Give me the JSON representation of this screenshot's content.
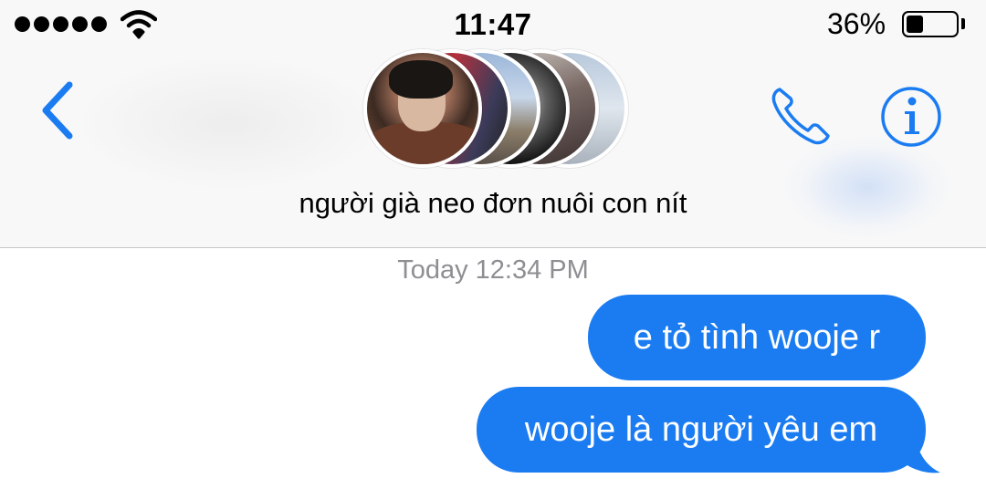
{
  "status_bar": {
    "time": "11:47",
    "battery_percent": "36%",
    "battery_level": 0.36,
    "signal_bars": 5
  },
  "nav": {
    "back_icon": "chevron-left-icon",
    "call_icon": "phone-icon",
    "info_icon": "info-icon",
    "accent_color": "#1b7cf2"
  },
  "conversation": {
    "title": "người già neo đơn nuôi con nít",
    "participant_avatar_count": 6
  },
  "messages": {
    "timestamp": "Today 12:34 PM",
    "items": [
      {
        "text": "e tỏ tình wooje r",
        "direction": "outgoing"
      },
      {
        "text": "wooje là người yêu em",
        "direction": "outgoing"
      }
    ],
    "bubble_color": "#1b7cf2"
  }
}
